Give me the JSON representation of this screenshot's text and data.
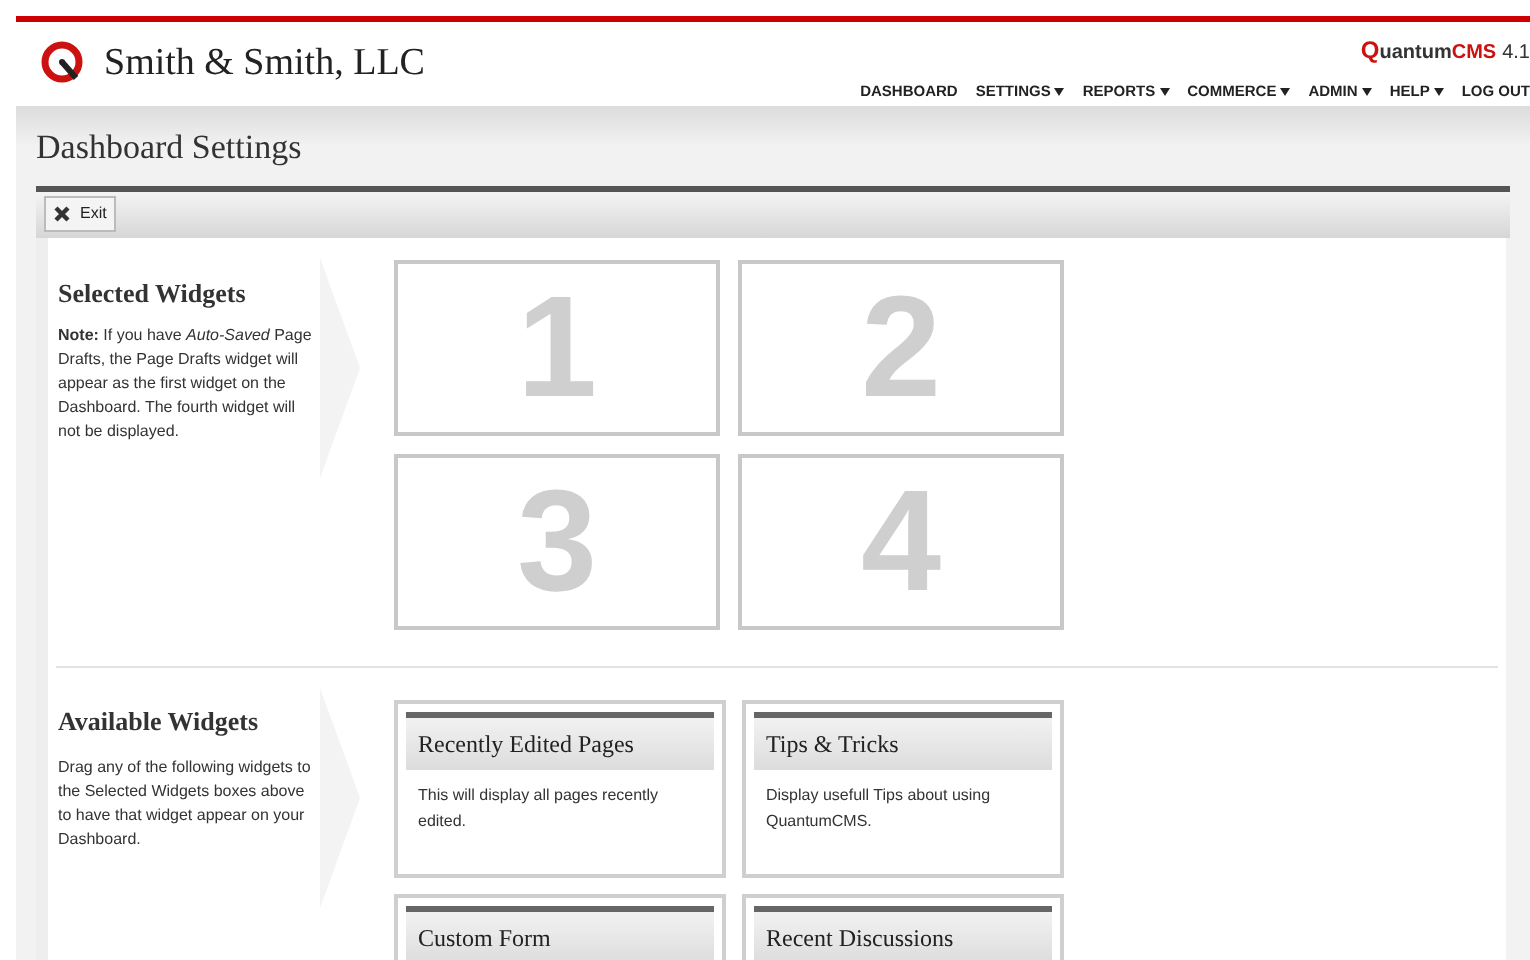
{
  "header": {
    "company": "Smith & Smith, LLC",
    "product": {
      "brand_q": "Q",
      "brand_rest": "uantum",
      "brand_cms": "CMS",
      "version": "4.1"
    },
    "nav": [
      {
        "label": "DASHBOARD",
        "has_menu": false
      },
      {
        "label": "SETTINGS",
        "has_menu": true
      },
      {
        "label": "REPORTS",
        "has_menu": true
      },
      {
        "label": "COMMERCE",
        "has_menu": true
      },
      {
        "label": "ADMIN",
        "has_menu": true
      },
      {
        "label": "HELP",
        "has_menu": true
      },
      {
        "label": "LOG OUT",
        "has_menu": false
      }
    ]
  },
  "page_title": "Dashboard Settings",
  "toolbar": {
    "buttons": [
      {
        "label": "Exit"
      }
    ]
  },
  "selected_widgets": {
    "heading": "Selected Widgets",
    "note": "**Note:** If you have *Auto-Saved* Page Drafts, the Page Drafts widget will appear as the first widget on the Dashboard. The fourth widget will not be displayed.",
    "slots": [
      "1",
      "2",
      "3",
      "4"
    ]
  },
  "available_widgets": {
    "heading": "Available Widgets",
    "description": "Drag any of the following widgets to the Selected Widgets boxes above to have that widget appear on your Dashboard.",
    "widgets": [
      {
        "title": "Recently Edited Pages",
        "description": "This will display all pages recently edited."
      },
      {
        "title": "Tips & Tricks",
        "description": "Display usefull Tips about using QuantumCMS."
      },
      {
        "title": "Custom Form"
      },
      {
        "title": "Recent Discussions"
      }
    ]
  }
}
